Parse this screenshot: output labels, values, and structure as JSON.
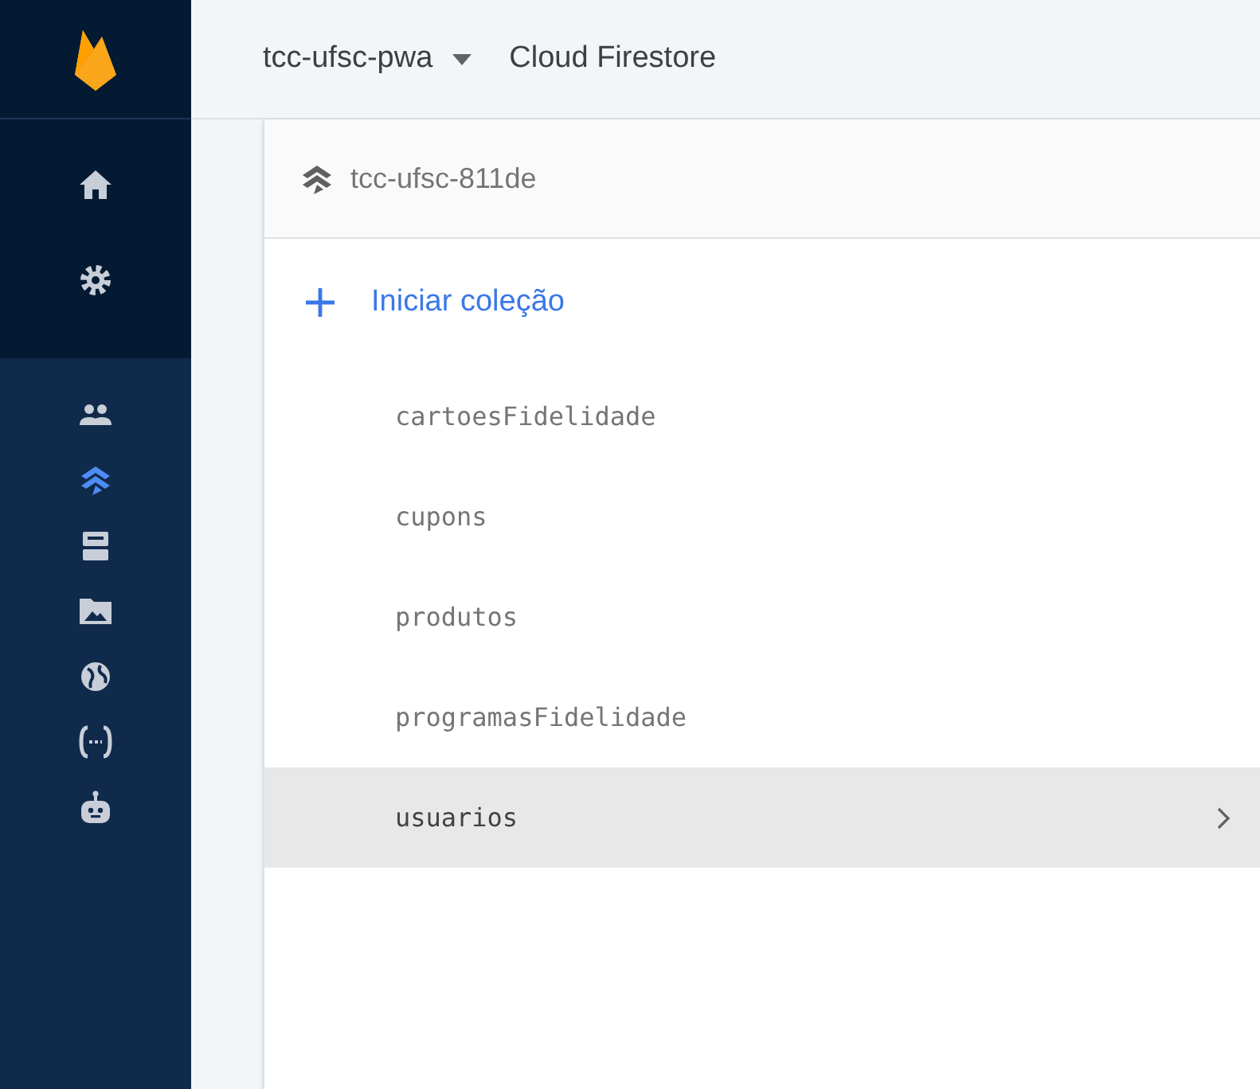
{
  "sidebar": {
    "items": [
      {
        "kind": "home",
        "selected": false
      },
      {
        "kind": "settings",
        "selected": false
      },
      {
        "kind": "users",
        "selected": false
      },
      {
        "kind": "firestore",
        "selected": true
      },
      {
        "kind": "server",
        "selected": false
      },
      {
        "kind": "folder",
        "selected": false
      },
      {
        "kind": "globe",
        "selected": false
      },
      {
        "kind": "functions",
        "selected": false
      },
      {
        "kind": "robot",
        "selected": false
      }
    ]
  },
  "header": {
    "project": "tcc-ufsc-pwa",
    "product": "Cloud Firestore"
  },
  "database": {
    "name": "tcc-ufsc-811de"
  },
  "start_collection": "Iniciar coleção",
  "collections": [
    {
      "name": "cartoesFidelidade",
      "selected": false
    },
    {
      "name": "cupons",
      "selected": false
    },
    {
      "name": "produtos",
      "selected": false
    },
    {
      "name": "programasFidelidade",
      "selected": false
    },
    {
      "name": "usuarios",
      "selected": true
    }
  ]
}
